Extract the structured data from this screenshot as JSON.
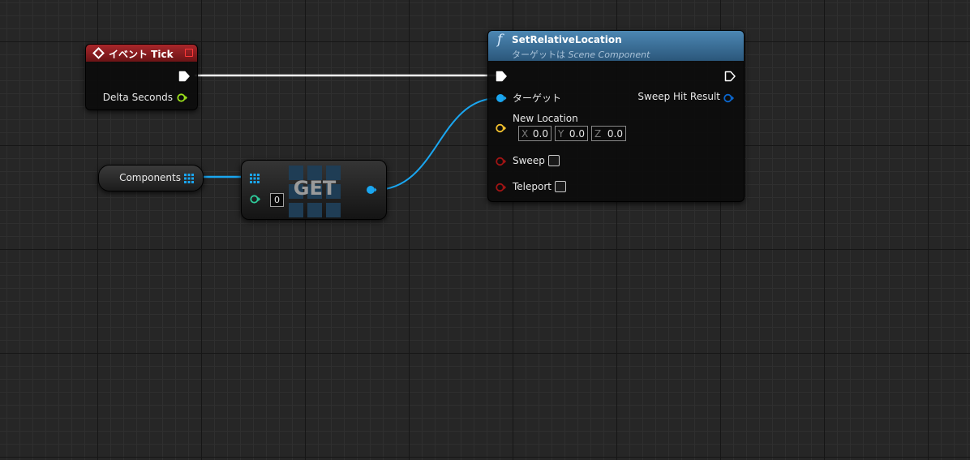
{
  "event_tick": {
    "title": "イベント Tick",
    "header_color": "#8b1a1a",
    "pin_delta_seconds": "Delta Seconds",
    "pin_color": "#9ce21c"
  },
  "components_var": {
    "label": "Components",
    "pin_color": "#1aa6f0"
  },
  "get_node": {
    "title": "GET",
    "index_value": "0",
    "index_pin_color": "#2ecc9c"
  },
  "set_relative_location": {
    "title": "SetRelativeLocation",
    "subtitle_prefix": "ターゲットは",
    "subtitle_class": "Scene Component",
    "function_icon": "f",
    "pin_target": "ターゲット",
    "pin_new_location": "New Location",
    "x_label": "X",
    "x_value": "0.0",
    "y_label": "Y",
    "y_value": "0.0",
    "z_label": "Z",
    "z_value": "0.0",
    "pin_sweep": "Sweep",
    "pin_teleport": "Teleport",
    "pin_sweep_hit_result": "Sweep Hit Result",
    "header_color": "#3a6c92",
    "object_pin_color": "#1aa6f0",
    "vector_pin_color": "#f2c12e",
    "bool_pin_color": "#8e0f0f",
    "struct_pin_color": "#0b66cc"
  },
  "wires": {
    "exec_color": "#ffffff",
    "object_color": "#1aa6f0"
  }
}
